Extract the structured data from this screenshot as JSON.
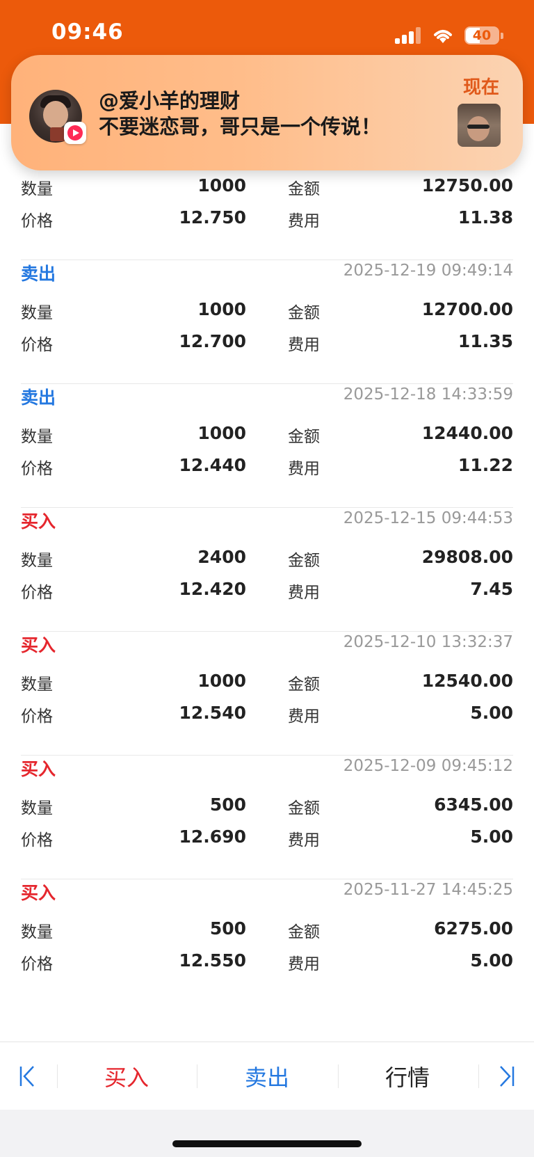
{
  "status": {
    "time": "09:46",
    "battery": "40"
  },
  "notification": {
    "title": "@爱小羊的理财",
    "body": "不要迷恋哥，哥只是一个传说！",
    "time": "现在"
  },
  "labels": {
    "quantity": "数量",
    "amount": "金额",
    "price": "价格",
    "fee": "费用"
  },
  "trades": [
    {
      "type": "",
      "time": "",
      "quantity": "1000",
      "amount": "12750.00",
      "price": "12.750",
      "fee": "11.38"
    },
    {
      "type": "卖出",
      "time": "2025-12-19 09:49:14",
      "quantity": "1000",
      "amount": "12700.00",
      "price": "12.700",
      "fee": "11.35"
    },
    {
      "type": "卖出",
      "time": "2025-12-18 14:33:59",
      "quantity": "1000",
      "amount": "12440.00",
      "price": "12.440",
      "fee": "11.22"
    },
    {
      "type": "买入",
      "time": "2025-12-15 09:44:53",
      "quantity": "2400",
      "amount": "29808.00",
      "price": "12.420",
      "fee": "7.45"
    },
    {
      "type": "买入",
      "time": "2025-12-10 13:32:37",
      "quantity": "1000",
      "amount": "12540.00",
      "price": "12.540",
      "fee": "5.00"
    },
    {
      "type": "买入",
      "time": "2025-12-09 09:45:12",
      "quantity": "500",
      "amount": "6345.00",
      "price": "12.690",
      "fee": "5.00"
    },
    {
      "type": "买入",
      "time": "2025-11-27 14:45:25",
      "quantity": "500",
      "amount": "6275.00",
      "price": "12.550",
      "fee": "5.00"
    }
  ],
  "bottom_nav": {
    "buy": "买入",
    "sell": "卖出",
    "quote": "行情"
  },
  "colors": {
    "header": "#ec5a0b",
    "sell": "#2478e0",
    "buy": "#e5262d"
  }
}
